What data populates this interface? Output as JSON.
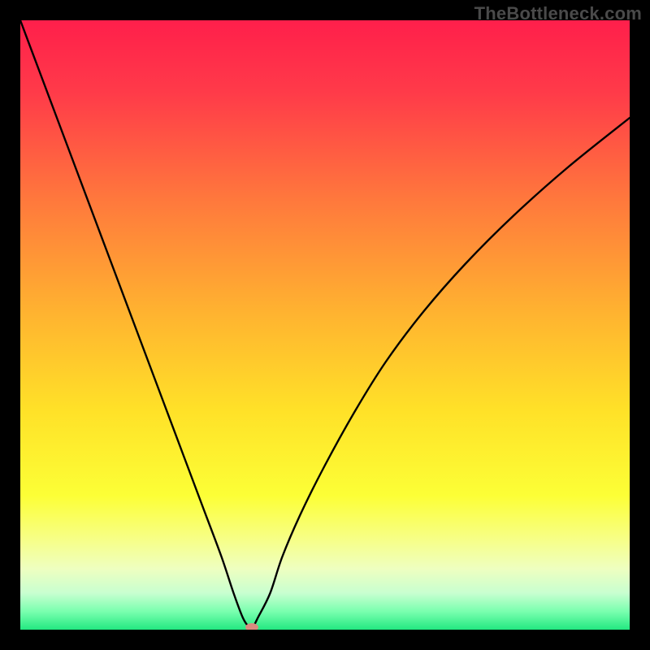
{
  "watermark": "TheBottleneck.com",
  "chart_data": {
    "type": "line",
    "title": "",
    "xlabel": "",
    "ylabel": "",
    "xlim": [
      0,
      100
    ],
    "ylim": [
      0,
      100
    ],
    "background_gradient": {
      "stops": [
        {
          "offset": 0.0,
          "color": "#ff1f4b"
        },
        {
          "offset": 0.12,
          "color": "#ff3b49"
        },
        {
          "offset": 0.3,
          "color": "#ff7a3c"
        },
        {
          "offset": 0.48,
          "color": "#ffb330"
        },
        {
          "offset": 0.64,
          "color": "#ffe128"
        },
        {
          "offset": 0.78,
          "color": "#fcff36"
        },
        {
          "offset": 0.85,
          "color": "#f7ff85"
        },
        {
          "offset": 0.9,
          "color": "#eeffc0"
        },
        {
          "offset": 0.94,
          "color": "#c8ffd0"
        },
        {
          "offset": 0.97,
          "color": "#7affaf"
        },
        {
          "offset": 1.0,
          "color": "#23e981"
        }
      ]
    },
    "series": [
      {
        "name": "bottleneck-curve",
        "color": "#000000",
        "x": [
          0,
          3,
          6,
          9,
          12,
          15,
          18,
          21,
          24,
          27,
          30,
          33,
          35,
          36.5,
          37.5,
          38.2,
          39,
          41,
          43,
          46,
          50,
          55,
          60,
          66,
          73,
          81,
          90,
          100
        ],
        "values": [
          100,
          92,
          84,
          76,
          68,
          60,
          52,
          44,
          36,
          28,
          20,
          12,
          6,
          2,
          0.5,
          0.5,
          2,
          6,
          12,
          19,
          27,
          36,
          44,
          52,
          60,
          68,
          76,
          84
        ]
      }
    ],
    "marker": {
      "name": "optimal-point",
      "x": 38,
      "y": 0,
      "color": "#d98a7f",
      "rx": 8,
      "ry": 5
    }
  }
}
